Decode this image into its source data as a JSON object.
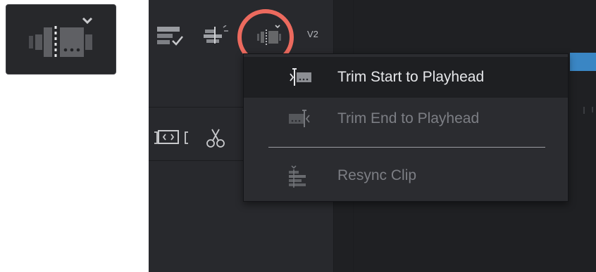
{
  "timeline": {
    "track_label": "V2"
  },
  "dropdown": {
    "items": [
      {
        "label": "Trim Start to Playhead",
        "icon": "trim-start-icon",
        "state": "hovered"
      },
      {
        "label": "Trim End to Playhead",
        "icon": "trim-end-icon",
        "state": "disabled"
      },
      {
        "label": "Resync Clip",
        "icon": "resync-clip-icon",
        "state": "disabled"
      }
    ]
  },
  "colors": {
    "highlight_ring": "#ec6a5e",
    "menu_background": "#2b2c30",
    "hover_background": "#1e1f22",
    "timeline_clip": "#3a86c4"
  }
}
